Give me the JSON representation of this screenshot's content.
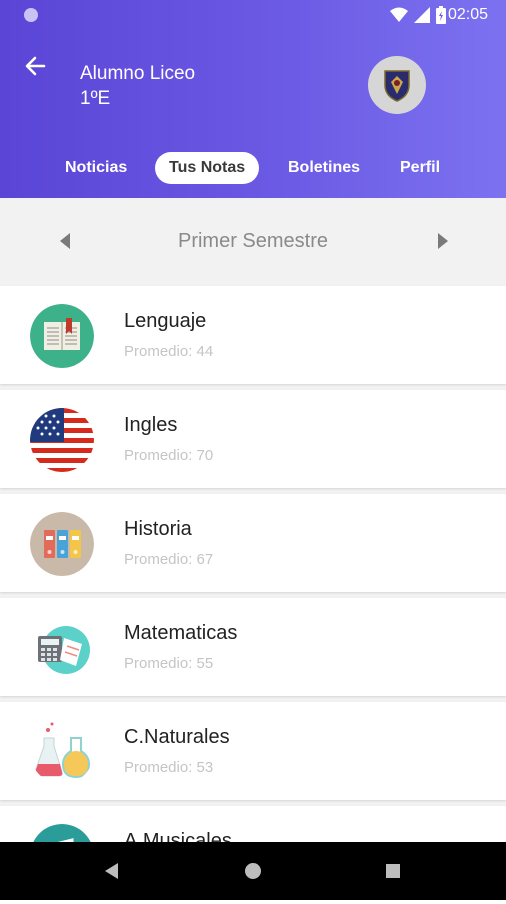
{
  "status_bar": {
    "time": "02:05"
  },
  "header": {
    "student_name": "Alumno Liceo",
    "class": "1ºE"
  },
  "tabs": [
    {
      "label": "Noticias",
      "active": false
    },
    {
      "label": "Tus Notas",
      "active": true
    },
    {
      "label": "Boletines",
      "active": false
    },
    {
      "label": "Perfil",
      "active": false
    }
  ],
  "semester": {
    "label": "Primer Semestre"
  },
  "subjects": [
    {
      "name": "Lenguaje",
      "average_label": "Promedio: 44",
      "icon": "book-icon"
    },
    {
      "name": "Ingles",
      "average_label": "Promedio: 70",
      "icon": "us-flag-icon"
    },
    {
      "name": "Historia",
      "average_label": "Promedio: 67",
      "icon": "binders-icon"
    },
    {
      "name": "Matematicas",
      "average_label": "Promedio: 55",
      "icon": "calculator-icon"
    },
    {
      "name": "C.Naturales",
      "average_label": "Promedio: 53",
      "icon": "flasks-icon"
    },
    {
      "name": "A.Musicales",
      "average_label": "",
      "icon": "music-icon"
    }
  ],
  "colors": {
    "header_start": "#5a45d6",
    "header_end": "#7c72f0",
    "accent": "#ffffff"
  }
}
